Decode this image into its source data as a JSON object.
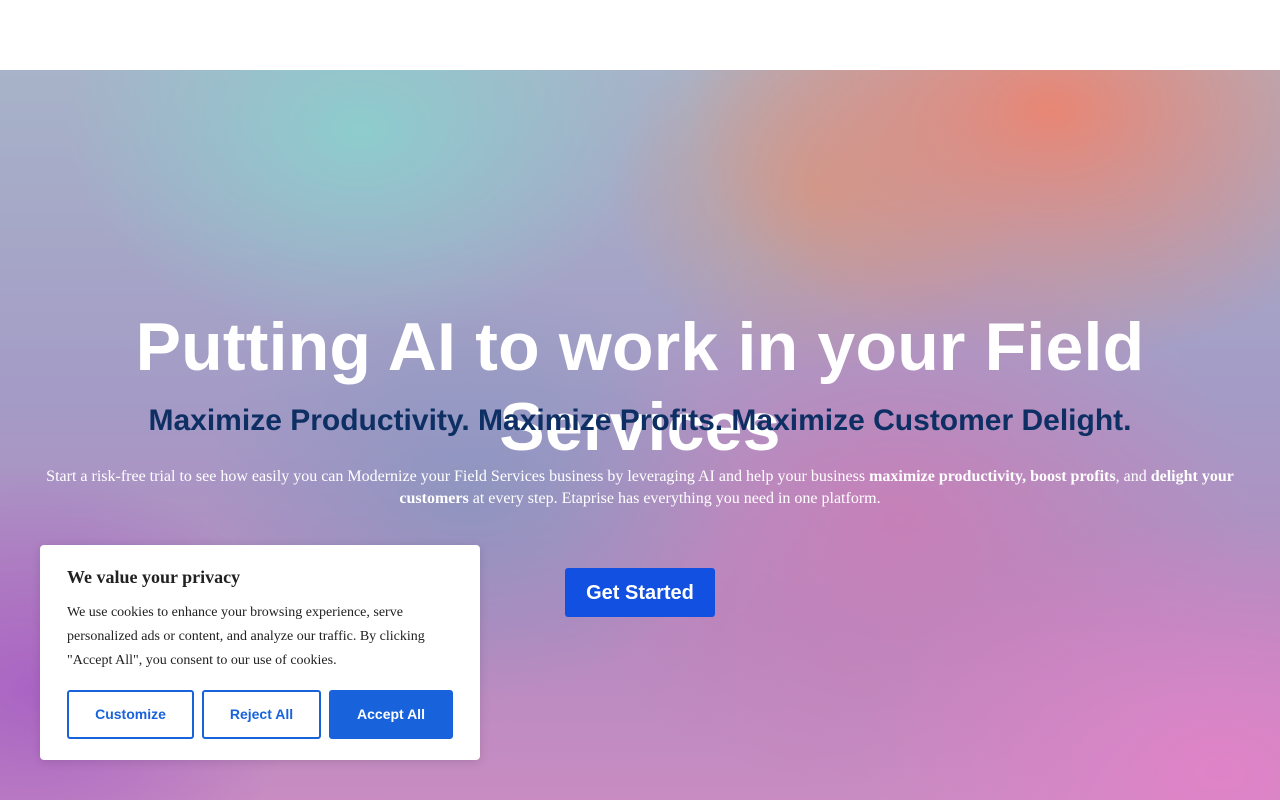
{
  "hero": {
    "headline": "Putting AI to work in your Field Services",
    "subheadline": "Maximize Productivity. Maximize Profits. Maximize Customer Delight.",
    "description": {
      "part1": "Start a risk-free trial to see how easily you can Modernize your Field Services business by leveraging AI and help your business ",
      "bold1": "maximize productivity, boost profits",
      "part2": ", and ",
      "bold2": "delight your customers",
      "part3": " at every step. Etaprise has everything you need in one platform."
    },
    "cta_label": "Get Started"
  },
  "cookie_banner": {
    "title": "We value your privacy",
    "text": "We use cookies to enhance your browsing experience, serve personalized ads or content, and analyze our traffic. By clicking \"Accept All\", you consent to our use of cookies.",
    "customize_label": "Customize",
    "reject_label": "Reject All",
    "accept_label": "Accept All"
  },
  "colors": {
    "subheadline": "#0e2f63",
    "cta": "#1150e0",
    "cookie_accent": "#1863dc"
  }
}
